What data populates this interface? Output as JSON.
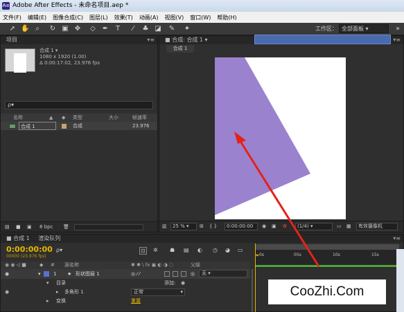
{
  "title": "Adobe After Effects - 未命名项目.aep *",
  "menu": [
    "文件(F)",
    "编辑(E)",
    "图像合成(C)",
    "图层(L)",
    "效果(T)",
    "动画(A)",
    "视图(V)",
    "窗口(W)",
    "帮助(H)"
  ],
  "toolbar": {
    "workspace_label": "工作区：",
    "workspace_value": "全部面板"
  },
  "project": {
    "tab": "项目",
    "comp_name": "合成 1 ▾",
    "comp_size": "1080 x 1920 (1.00)",
    "comp_duration": "Δ 0:00:17:02, 23.976 fps",
    "search_placeholder": "ρ▾",
    "columns": {
      "name": "名称",
      "type": "类型",
      "size": "大小",
      "fps": "帧速率"
    },
    "row": {
      "name": "合成 1",
      "type": "合成",
      "fps": "23.976"
    },
    "bpc": "8 bpc"
  },
  "composition": {
    "tab": "合成: 合成 1 ▾",
    "subtab": "合成 1",
    "zoom": "25 %",
    "timecode": "0:00:00:00",
    "resolution": "(1/4)",
    "view": "有效摄像机",
    "shape_color": "#9b82cf"
  },
  "timeline": {
    "tab1": "合成 1",
    "tab2": "渲染队列",
    "time": "0:00:00:00",
    "fps_frames": "00000 (23.976 fps)",
    "ruler": [
      "0s",
      "05s",
      "10s",
      "15s"
    ],
    "layer_head_name": "源名称",
    "layer_head_parent": "父级",
    "layer_index": "1",
    "layer_name": "形状图层 1",
    "parent_value": "无",
    "prop_contents": "目录",
    "add_label": "添加:",
    "prop_polygon": "多角形 1",
    "blend_value": "正常",
    "prop_transform": "变换",
    "reset_label": "重置"
  },
  "watermark": "CooZhi.Com",
  "arrow_color": "#e2231a"
}
